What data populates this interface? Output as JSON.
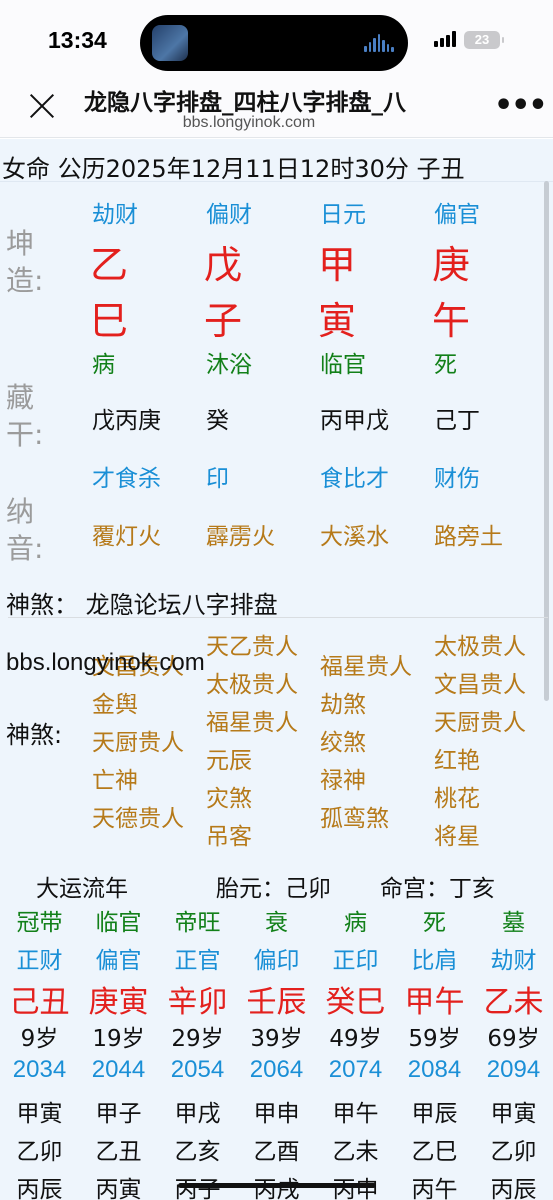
{
  "status": {
    "time": "13:34",
    "battery": "23"
  },
  "nav": {
    "title": "龙隐八字排盘_四柱八字排盘_八",
    "url": "bbs.longyinok.com"
  },
  "summary": "女命 公历2025年12月11日12时30分 子丑",
  "side_labels": {
    "kunzao": [
      "坤",
      "造:"
    ],
    "canggan": [
      "藏",
      "干:"
    ],
    "nayin": [
      "纳",
      "音:"
    ],
    "shensha": "神煞:"
  },
  "pillars": [
    {
      "shishen": "劫财",
      "gan": "乙",
      "zhi": "巳",
      "changsheng": "病",
      "canggan": "戊丙庚",
      "canggan_shishen": "才食杀",
      "nayin": "覆灯火"
    },
    {
      "shishen": "偏财",
      "gan": "戊",
      "zhi": "子",
      "changsheng": "沐浴",
      "canggan": "癸",
      "canggan_shishen": "印",
      "nayin": "霹雳火"
    },
    {
      "shishen": "日元",
      "gan": "甲",
      "zhi": "寅",
      "changsheng": "临官",
      "canggan": "丙甲戊",
      "canggan_shishen": "食比才",
      "nayin": "大溪水"
    },
    {
      "shishen": "偏官",
      "gan": "庚",
      "zhi": "午",
      "changsheng": "死",
      "canggan": "己丁",
      "canggan_shishen": "财伤",
      "nayin": "路旁土"
    }
  ],
  "shensha_header": "神煞：  龙隐论坛八字排盘",
  "watermark": "bbs.longyinok.com",
  "shensha": [
    [
      "文昌贵人",
      "金舆",
      "天厨贵人",
      "亡神",
      "天德贵人"
    ],
    [
      "天乙贵人",
      "太极贵人",
      "福星贵人",
      "元辰",
      "灾煞",
      "吊客"
    ],
    [
      "福星贵人",
      "劫煞",
      "绞煞",
      "禄神",
      "孤鸾煞"
    ],
    [
      "太极贵人",
      "文昌贵人",
      "天厨贵人",
      "红艳",
      "桃花",
      "将星"
    ]
  ],
  "yun_header": {
    "title": "大运流年",
    "taiyuan": "胎元：己卯",
    "minggong": "命宫：丁亥"
  },
  "dayun": [
    {
      "changsheng": "冠带",
      "shishen": "正财",
      "ganzhi": "己丑",
      "age": "9岁",
      "year": "2034",
      "liunian": [
        "甲寅",
        "乙卯",
        "丙辰"
      ]
    },
    {
      "changsheng": "临官",
      "shishen": "偏官",
      "ganzhi": "庚寅",
      "age": "19岁",
      "year": "2044",
      "liunian": [
        "甲子",
        "乙丑",
        "丙寅"
      ]
    },
    {
      "changsheng": "帝旺",
      "shishen": "正官",
      "ganzhi": "辛卯",
      "age": "29岁",
      "year": "2054",
      "liunian": [
        "甲戌",
        "乙亥",
        "丙子"
      ]
    },
    {
      "changsheng": "衰",
      "shishen": "偏印",
      "ganzhi": "壬辰",
      "age": "39岁",
      "year": "2064",
      "liunian": [
        "甲申",
        "乙酉",
        "丙戌"
      ]
    },
    {
      "changsheng": "病",
      "shishen": "正印",
      "ganzhi": "癸巳",
      "age": "49岁",
      "year": "2074",
      "liunian": [
        "甲午",
        "乙未",
        "丙申"
      ]
    },
    {
      "changsheng": "死",
      "shishen": "比肩",
      "ganzhi": "甲午",
      "age": "59岁",
      "year": "2084",
      "liunian": [
        "甲辰",
        "乙巳",
        "丙午"
      ]
    },
    {
      "changsheng": "墓",
      "shishen": "劫财",
      "ganzhi": "乙未",
      "age": "69岁",
      "year": "2094",
      "liunian": [
        "甲寅",
        "乙卯",
        "丙辰"
      ]
    }
  ]
}
